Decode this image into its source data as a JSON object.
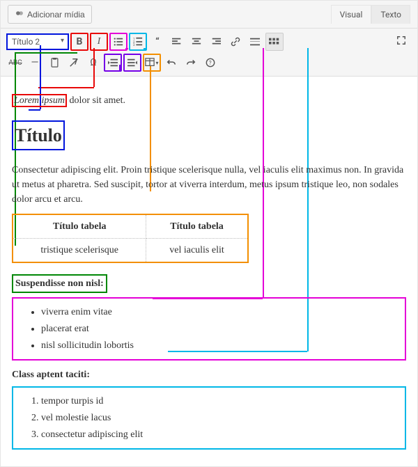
{
  "top": {
    "add_media": "Adicionar mídia",
    "tab_visual": "Visual",
    "tab_text": "Texto"
  },
  "toolbar": {
    "format_selected": "Título 2"
  },
  "content": {
    "lorem": "Lorem ipsum",
    "lorem_tail": " dolor sit amet.",
    "h2": "Título",
    "para": "Consectetur adipiscing elit. Proin tristique scelerisque nulla, vel iaculis elit maximus non. In gravida ut metus at pharetra. Sed suscipit, tortor at viverra interdum, metus ipsum tristique leo, non sodales dolor arcu et arcu.",
    "table": {
      "th1": "Título tabela",
      "th2": "Título tabela",
      "td1": "tristique scelerisque",
      "td2": "vel iaculis elit"
    },
    "sub_green": "Suspendisse non nisl:",
    "ul": [
      "viverra enim vitae",
      "placerat erat",
      "nisl sollicitudin lobortis"
    ],
    "class_label": "Class aptent taciti:",
    "ol": [
      "tempor turpis id",
      "vel molestie lacus",
      "consectetur adipiscing elit"
    ]
  }
}
